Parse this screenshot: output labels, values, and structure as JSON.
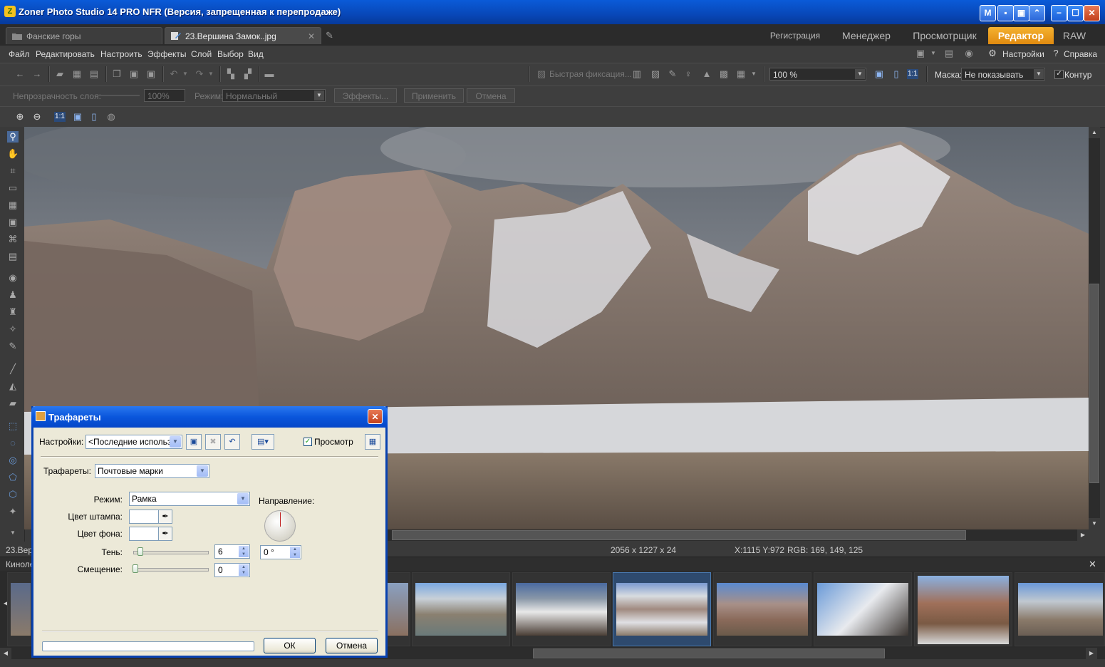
{
  "window": {
    "title": "Zoner Photo Studio 14 PRO NFR (Версия, запрещенная к перепродаже)",
    "controls": [
      "?",
      "−",
      "☐",
      "✕"
    ]
  },
  "tabs": {
    "docs": [
      {
        "label": "Фанские горы"
      },
      {
        "label": "23.Вершина Замок..jpg",
        "close": "✕"
      }
    ],
    "modes": [
      "Регистрация",
      "Менеджер",
      "Просмотрщик",
      "Редактор",
      "RAW"
    ]
  },
  "menu": {
    "items": [
      "Файл",
      "Редактировать",
      "Настроить",
      "Эффекты",
      "Слой",
      "Выбор",
      "Вид"
    ],
    "settings": "Настройки",
    "help": "Справка"
  },
  "toolbar": {
    "quick_fix": "Быстрая фиксация...",
    "zoom": "100 %",
    "mask_label": "Маска:",
    "mask_value": "Не показывать",
    "contour_label": "Контур"
  },
  "layerbar": {
    "opacity_label": "Непрозрачность слоя:",
    "opacity_value": "100%",
    "mode_label": "Режим:",
    "mode_value": "Нормальный",
    "effects_btn": "Эффекты...",
    "apply_btn": "Применить",
    "cancel_btn": "Отмена"
  },
  "status": {
    "filename": "23.Вер",
    "dimensions": "2056 x 1227 x 24",
    "coords": "X:1115 Y:972",
    "rgb": "RGB: 169, 149, 125"
  },
  "filmstrip": {
    "label": "Киноле",
    "close": "✕"
  },
  "dialog": {
    "title": "Трафареты",
    "settings_label": "Настройки:",
    "settings_value": "<Последние использо",
    "preview_label": "Просмотр",
    "stencils_label": "Трафареты:",
    "stencils_value": "Почтовые марки",
    "mode_label": "Режим:",
    "mode_value": "Рамка",
    "stamp_color_label": "Цвет штампа:",
    "bg_color_label": "Цвет фона:",
    "shadow_label": "Тень:",
    "shadow_value": "6",
    "offset_label": "Смещение:",
    "offset_value": "0",
    "direction_label": "Направление:",
    "direction_value": "0 °",
    "ok": "ОК",
    "cancel": "Отмена"
  },
  "colors": {
    "accent_tab": "#f0a020",
    "xp_title": "#0a56dc"
  }
}
